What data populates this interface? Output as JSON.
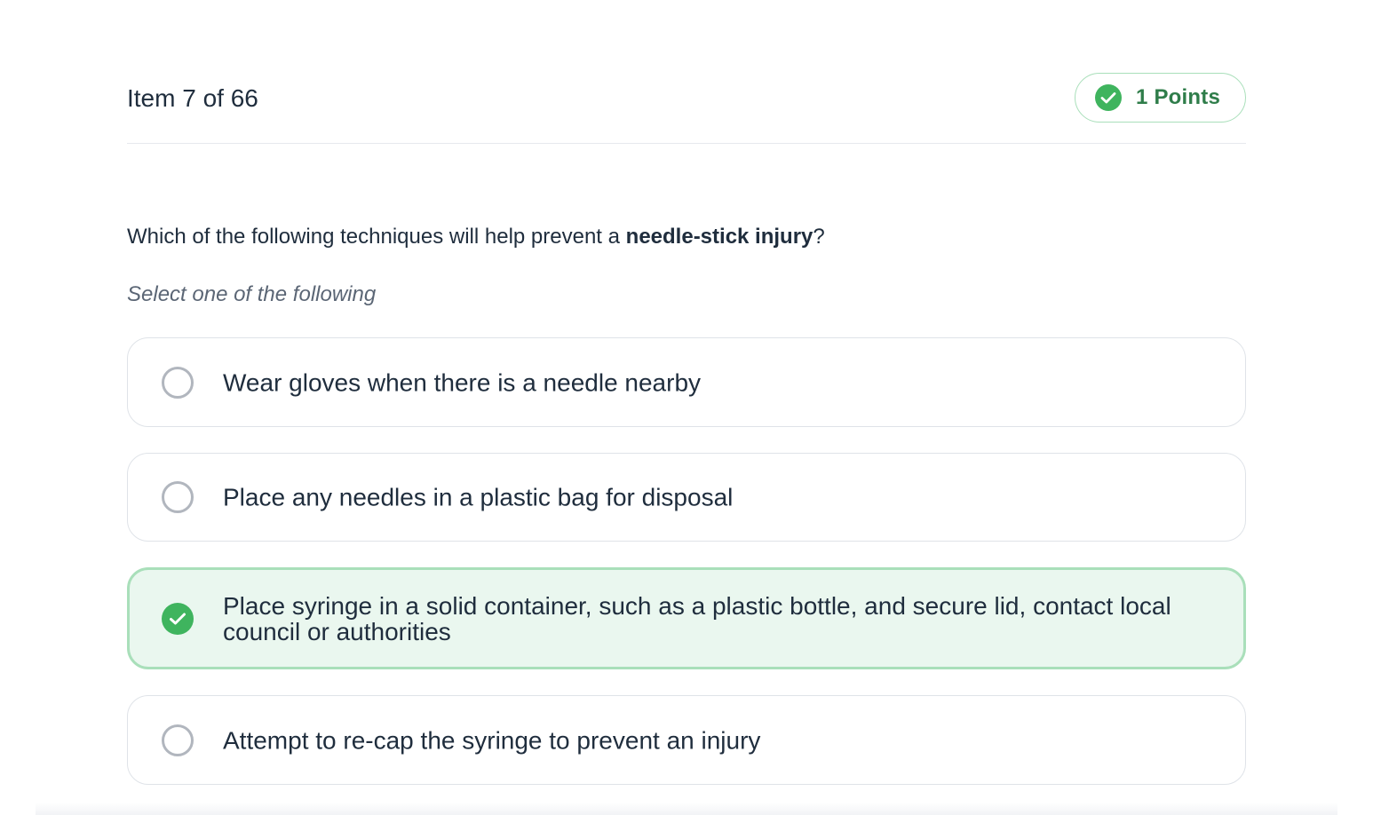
{
  "header": {
    "item_counter": "Item 7 of 66",
    "points_label": "1 Points",
    "points_icon": "check-circle-icon"
  },
  "question": {
    "prefix": "Which of the following techniques will help prevent a ",
    "emphasis": "needle-stick injury",
    "suffix": "?",
    "instruction": "Select one of the following"
  },
  "options": [
    {
      "label": "Wear gloves when there is a needle nearby",
      "state": "unselected"
    },
    {
      "label": "Place any needles in a plastic bag for disposal",
      "state": "unselected"
    },
    {
      "label": "Place syringe in a solid container, such as a plastic bottle, and secure lid, contact local council or authorities",
      "state": "correct"
    },
    {
      "label": "Attempt to re-cap the syringe to prevent an injury",
      "state": "unselected"
    }
  ],
  "colors": {
    "accent_green": "#3fb45e",
    "correct_bg": "#eaf7ef",
    "correct_border": "#a9dfba",
    "text_primary": "#1f2d3d",
    "text_muted": "#5b6675"
  }
}
